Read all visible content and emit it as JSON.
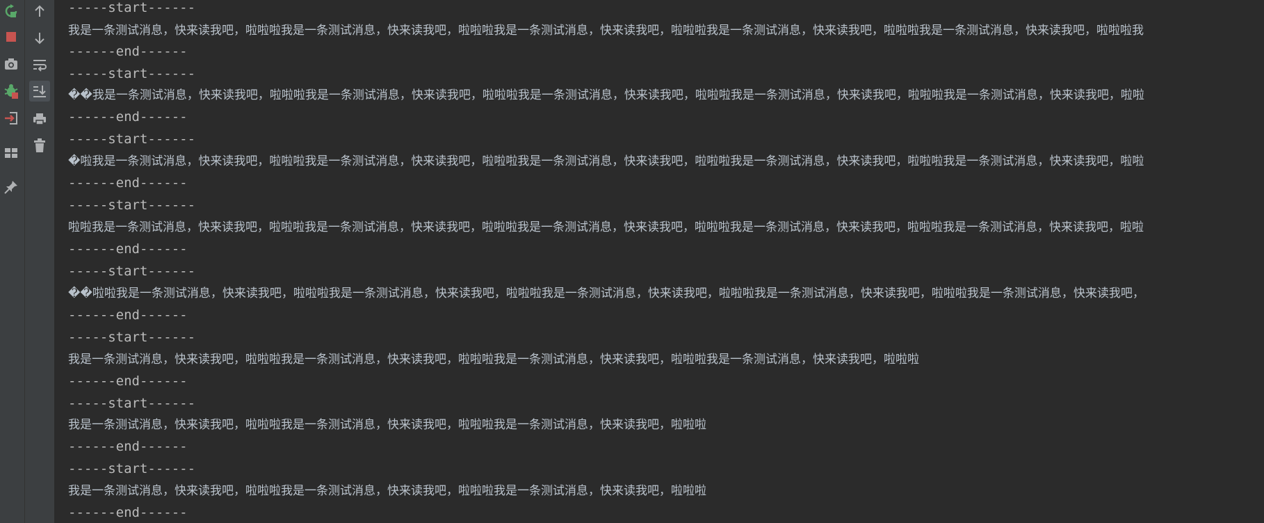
{
  "toolbar_left": {
    "icons": [
      "rerun-icon",
      "stop-icon",
      "camera-icon",
      "debug-bug-icon",
      "exit-icon",
      "layout-icon",
      "pin-icon"
    ],
    "colors": {
      "rerun": "#59a869",
      "stop": "#c75450",
      "neutral": "#afb1b3"
    }
  },
  "toolbar_console": {
    "icons": [
      "arrow-up-icon",
      "arrow-down-icon",
      "soft-wrap-icon",
      "scroll-to-end-icon",
      "print-icon",
      "trash-icon"
    ],
    "active": "scroll-to-end-icon"
  },
  "console": {
    "lines": [
      "-----start------",
      "我是一条测试消息，快来读我吧，啦啦啦我是一条测试消息，快来读我吧，啦啦啦我是一条测试消息，快来读我吧，啦啦啦我是一条测试消息，快来读我吧，啦啦啦我是一条测试消息，快来读我吧，啦啦啦我",
      "------end------",
      "-----start------",
      "��我是一条测试消息，快来读我吧，啦啦啦我是一条测试消息，快来读我吧，啦啦啦我是一条测试消息，快来读我吧，啦啦啦我是一条测试消息，快来读我吧，啦啦啦我是一条测试消息，快来读我吧，啦啦",
      "------end------",
      "-----start------",
      "�啦我是一条测试消息，快来读我吧，啦啦啦我是一条测试消息，快来读我吧，啦啦啦我是一条测试消息，快来读我吧，啦啦啦我是一条测试消息，快来读我吧，啦啦啦我是一条测试消息，快来读我吧，啦啦",
      "------end------",
      "-----start------",
      "啦啦我是一条测试消息，快来读我吧，啦啦啦我是一条测试消息，快来读我吧，啦啦啦我是一条测试消息，快来读我吧，啦啦啦我是一条测试消息，快来读我吧，啦啦啦我是一条测试消息，快来读我吧，啦啦",
      "------end------",
      "-----start------",
      "��啦啦我是一条测试消息，快来读我吧，啦啦啦我是一条测试消息，快来读我吧，啦啦啦我是一条测试消息，快来读我吧，啦啦啦我是一条测试消息，快来读我吧，啦啦啦我是一条测试消息，快来读我吧，",
      "------end------",
      "-----start------",
      "我是一条测试消息，快来读我吧，啦啦啦我是一条测试消息，快来读我吧，啦啦啦我是一条测试消息，快来读我吧，啦啦啦我是一条测试消息，快来读我吧，啦啦啦",
      "------end------",
      "-----start------",
      "我是一条测试消息，快来读我吧，啦啦啦我是一条测试消息，快来读我吧，啦啦啦我是一条测试消息，快来读我吧，啦啦啦",
      "------end------",
      "-----start------",
      "我是一条测试消息，快来读我吧，啦啦啦我是一条测试消息，快来读我吧，啦啦啦我是一条测试消息，快来读我吧，啦啦啦",
      "------end------"
    ]
  }
}
